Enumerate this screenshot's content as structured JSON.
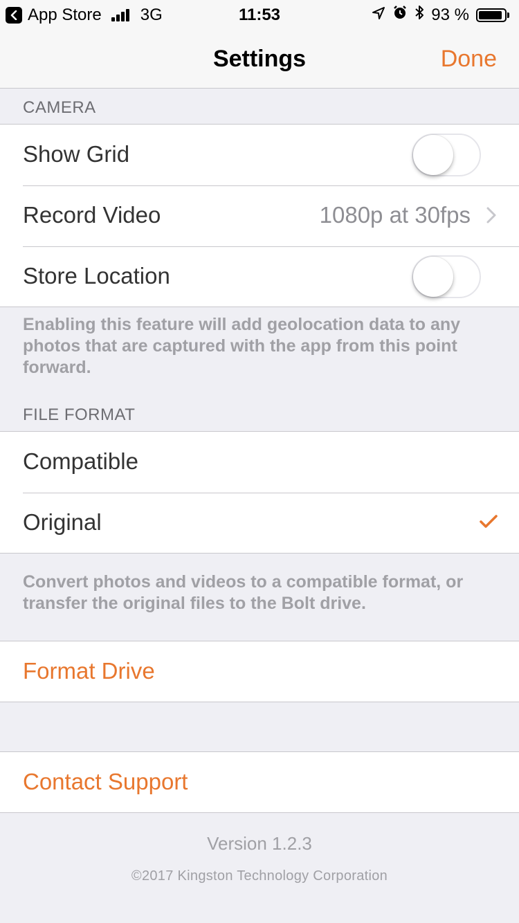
{
  "status_bar": {
    "back_app": "App Store",
    "network": "3G",
    "time": "11:53",
    "battery_percent": "93 %",
    "battery_level": 0.93
  },
  "nav": {
    "title": "Settings",
    "done": "Done"
  },
  "camera": {
    "header": "CAMERA",
    "show_grid": {
      "label": "Show Grid",
      "on": false
    },
    "record_video": {
      "label": "Record Video",
      "value": "1080p at 30fps"
    },
    "store_location": {
      "label": "Store Location",
      "on": false
    },
    "footer": "Enabling this feature will add geolocation data to any photos that are captured with the app from this point forward."
  },
  "file_format": {
    "header": "FILE FORMAT",
    "options": [
      "Compatible",
      "Original"
    ],
    "selected": "Original",
    "footer": "Convert photos and videos to a compatible format, or transfer the original files to the Bolt drive."
  },
  "actions": {
    "format_drive": "Format Drive",
    "contact_support": "Contact Support"
  },
  "about": {
    "version": "Version 1.2.3",
    "copyright": "©2017 Kingston Technology Corporation"
  },
  "colors": {
    "accent": "#e8772e",
    "background": "#efeff4"
  },
  "icons": [
    "back-icon",
    "location-arrow-icon",
    "alarm-icon",
    "bluetooth-icon",
    "battery-icon",
    "chevron-right-icon",
    "checkmark-icon"
  ]
}
